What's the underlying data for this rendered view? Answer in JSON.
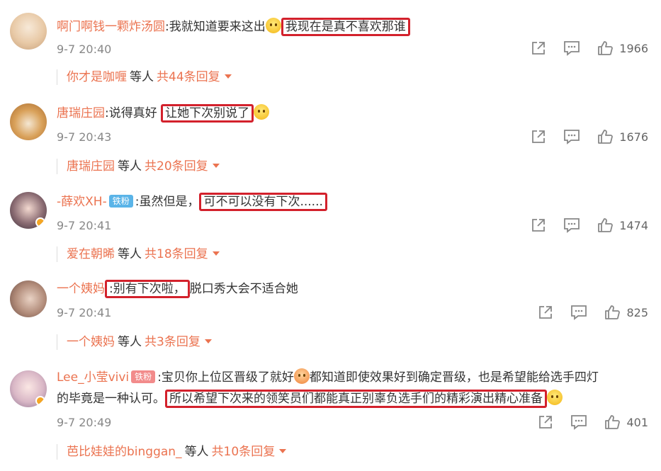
{
  "comments": [
    {
      "user": "啊门啊钱一颗炸汤圆",
      "pre": ":我就知道要来这出",
      "highlight": "我现在是真不喜欢那谁",
      "post": "",
      "time": "9-7 20:40",
      "likes": "1966",
      "reply_user": "你才是咖喱",
      "reply_mid": "等人",
      "reply_count": "共44条回复"
    },
    {
      "user": "唐瑞庄园",
      "pre": ":说得真好",
      "highlight": "让她下次别说了",
      "post": "",
      "time": "9-7 20:43",
      "likes": "1676",
      "reply_user": "唐瑞庄园",
      "reply_mid": "等人",
      "reply_count": "共20条回复"
    },
    {
      "user": "-薛欢XH-",
      "badge": "铁粉",
      "pre": ":虽然但是，",
      "highlight": "可不可以没有下次......",
      "post": "",
      "time": "9-7 20:41",
      "likes": "1474",
      "reply_user": "爱在朝晞",
      "reply_mid": "等人",
      "reply_count": "共18条回复"
    },
    {
      "user": "一个姨妈",
      "pre": "",
      "highlight": ":别有下次啦，",
      "post": "脱口秀大会不适合她",
      "time": "9-7 20:41",
      "likes": "825",
      "reply_user": "一个姨妈",
      "reply_mid": "等人",
      "reply_count": "共3条回复"
    },
    {
      "user": "Lee_小莹vivi",
      "badge": "铁粉",
      "pre": ":宝贝你上位区晋级了就好",
      "pre2": "都知道即使效果好到确定晋级，也是希望能给选手四灯",
      "line2_pre": "的毕竟是一种认可。",
      "highlight": "所以希望下次来的领笑员们都能真正别辜负选手们的精彩演出精心准备",
      "time": "9-7 20:49",
      "likes": "401",
      "reply_user": "芭比娃娃的binggan_",
      "reply_mid": "等人",
      "reply_count": "共10条回复"
    }
  ],
  "icons": {
    "share": "share-icon",
    "comment": "comment-icon",
    "like": "like-icon"
  },
  "colors": {
    "username": "#eb7350",
    "highlight_border": "#d3212c",
    "badge": "#5ab4e8"
  }
}
